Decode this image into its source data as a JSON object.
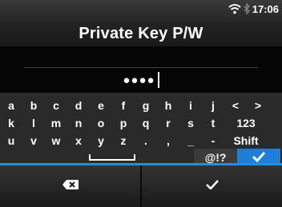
{
  "status": {
    "time": "17:06"
  },
  "title": "Private Key P/W",
  "password": {
    "masked_value": "●●●●"
  },
  "keyboard": {
    "row1": [
      "a",
      "b",
      "c",
      "d",
      "e",
      "f",
      "g",
      "h",
      "i",
      "j",
      "<",
      ">"
    ],
    "row2": [
      "k",
      "l",
      "m",
      "n",
      "o",
      "p",
      "q",
      "r",
      "s",
      "t",
      "123"
    ],
    "row3": [
      "u",
      "v",
      "w",
      "x",
      "y",
      "z",
      ".",
      ",",
      "_",
      "-",
      "Shift"
    ],
    "row4": {
      "symbols": "@!?"
    }
  },
  "colors": {
    "accent": "#1d7fd8",
    "footer_line": "#1f8fe0"
  },
  "icons": [
    "wifi-icon",
    "bluetooth-icon",
    "backspace-icon",
    "checkmark-icon",
    "space-bar-icon"
  ]
}
